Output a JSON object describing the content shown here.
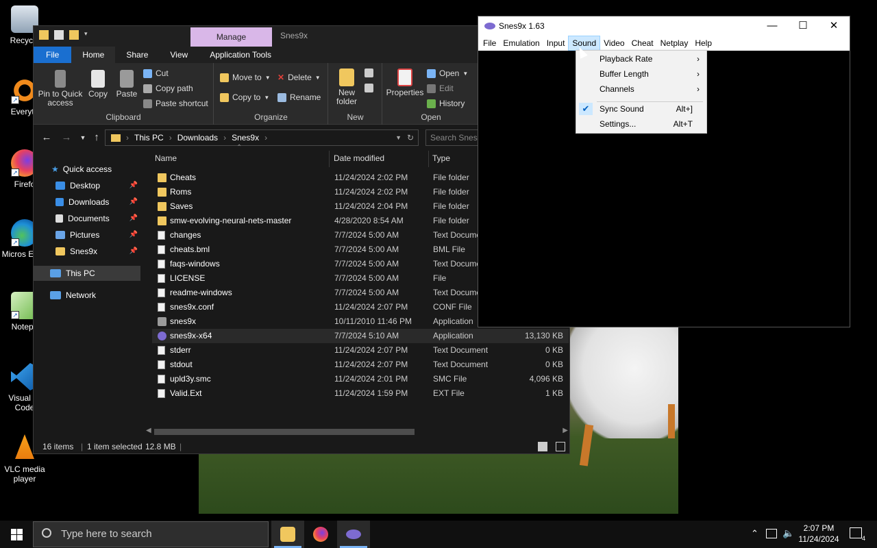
{
  "desktop": {
    "icons": [
      {
        "label": "Recycle",
        "icon": "recycle-bin-icon"
      },
      {
        "label": "Everyth",
        "icon": "everything-search-icon"
      },
      {
        "label": "Firefo",
        "icon": "firefox-icon"
      },
      {
        "label": "Micros Edge",
        "icon": "edge-icon"
      },
      {
        "label": "Notepa",
        "icon": "notepad-icon"
      },
      {
        "label": "Visual St Code",
        "icon": "vscode-icon"
      },
      {
        "label": "VLC media player",
        "icon": "vlc-icon"
      }
    ]
  },
  "explorer": {
    "title": "Snes9x",
    "manage_tab": "Manage",
    "ribbon_tabs": [
      "File",
      "Home",
      "Share",
      "View",
      "Application Tools"
    ],
    "ribbon": {
      "pin_label": "Pin to Quick access",
      "copy_label": "Copy",
      "paste_label": "Paste",
      "cut_label": "Cut",
      "copy_path_label": "Copy path",
      "paste_shortcut_label": "Paste shortcut",
      "clipboard_group": "Clipboard",
      "move_to_label": "Move to",
      "copy_to_label": "Copy to",
      "delete_label": "Delete",
      "rename_label": "Rename",
      "organize_group": "Organize",
      "new_folder_label": "New folder",
      "new_group": "New",
      "properties_label": "Properties",
      "open_label": "Open",
      "edit_label": "Edit",
      "history_label": "History",
      "open_group": "Open"
    },
    "address": {
      "crumbs": [
        "This PC",
        "Downloads",
        "Snes9x"
      ],
      "search_placeholder": "Search Snes9x"
    },
    "nav": [
      {
        "label": "Quick access",
        "icon": "star-icon",
        "pinned": false
      },
      {
        "label": "Desktop",
        "icon": "desktop-icon",
        "pinned": true
      },
      {
        "label": "Downloads",
        "icon": "download-icon",
        "pinned": true
      },
      {
        "label": "Documents",
        "icon": "documents-icon",
        "pinned": true
      },
      {
        "label": "Pictures",
        "icon": "pictures-icon",
        "pinned": true
      },
      {
        "label": "Snes9x",
        "icon": "folder-icon",
        "pinned": true
      },
      {
        "label": "This PC",
        "icon": "computer-icon",
        "pinned": false
      },
      {
        "label": "Network",
        "icon": "network-icon",
        "pinned": false
      }
    ],
    "columns": [
      "Name",
      "Date modified",
      "Type"
    ],
    "files": [
      {
        "name": "Cheats",
        "date": "11/24/2024 2:02 PM",
        "type": "File folder",
        "size": "",
        "kind": "folder"
      },
      {
        "name": "Roms",
        "date": "11/24/2024 2:02 PM",
        "type": "File folder",
        "size": "",
        "kind": "folder"
      },
      {
        "name": "Saves",
        "date": "11/24/2024 2:04 PM",
        "type": "File folder",
        "size": "",
        "kind": "folder"
      },
      {
        "name": "smw-evolving-neural-nets-master",
        "date": "4/28/2020 8:54 AM",
        "type": "File folder",
        "size": "",
        "kind": "folder"
      },
      {
        "name": "changes",
        "date": "7/7/2024 5:00 AM",
        "type": "Text Docume",
        "size": "",
        "kind": "doc"
      },
      {
        "name": "cheats.bml",
        "date": "7/7/2024 5:00 AM",
        "type": "BML File",
        "size": "",
        "kind": "doc"
      },
      {
        "name": "faqs-windows",
        "date": "7/7/2024 5:00 AM",
        "type": "Text Docume",
        "size": "",
        "kind": "doc"
      },
      {
        "name": "LICENSE",
        "date": "7/7/2024 5:00 AM",
        "type": "File",
        "size": "",
        "kind": "doc"
      },
      {
        "name": "readme-windows",
        "date": "7/7/2024 5:00 AM",
        "type": "Text Docume",
        "size": "",
        "kind": "doc"
      },
      {
        "name": "snes9x.conf",
        "date": "11/24/2024 2:07 PM",
        "type": "CONF File",
        "size": "",
        "kind": "doc"
      },
      {
        "name": "snes9x",
        "date": "10/11/2010 11:46 PM",
        "type": "Application",
        "size": "",
        "kind": "app2"
      },
      {
        "name": "snes9x-x64",
        "date": "7/7/2024 5:10 AM",
        "type": "Application",
        "size": "13,130 KB",
        "kind": "app"
      },
      {
        "name": "stderr",
        "date": "11/24/2024 2:07 PM",
        "type": "Text Document",
        "size": "0 KB",
        "kind": "doc"
      },
      {
        "name": "stdout",
        "date": "11/24/2024 2:07 PM",
        "type": "Text Document",
        "size": "0 KB",
        "kind": "doc"
      },
      {
        "name": "upld3y.smc",
        "date": "11/24/2024 2:01 PM",
        "type": "SMC File",
        "size": "4,096 KB",
        "kind": "doc"
      },
      {
        "name": "Valid.Ext",
        "date": "11/24/2024 1:59 PM",
        "type": "EXT File",
        "size": "1 KB",
        "kind": "doc"
      }
    ],
    "selected_index": 11,
    "status": {
      "items": "16 items",
      "selected": "1 item selected",
      "size": "12.8 MB"
    }
  },
  "snes9x": {
    "title": "Snes9x 1.63",
    "menu": [
      "File",
      "Emulation",
      "Input",
      "Sound",
      "Video",
      "Cheat",
      "Netplay",
      "Help"
    ],
    "active_menu": "Sound",
    "sound_menu": {
      "playback_rate": "Playback Rate",
      "buffer_length": "Buffer Length",
      "channels": "Channels",
      "sync_sound": "Sync Sound",
      "sync_sound_key": "Alt+]",
      "sync_sound_checked": true,
      "settings": "Settings...",
      "settings_key": "Alt+T"
    }
  },
  "taskbar": {
    "search_placeholder": "Type here to search",
    "apps": [
      "file-explorer-icon",
      "firefox-icon",
      "snes9x-icon"
    ],
    "time": "2:07 PM",
    "date": "11/24/2024",
    "notification_count": "4"
  },
  "colors": {
    "accent": "#1a6fd0",
    "manage_tab": "#d9b7e8",
    "folder": "#f0c75e",
    "menu_highlight": "#cce8ff"
  }
}
